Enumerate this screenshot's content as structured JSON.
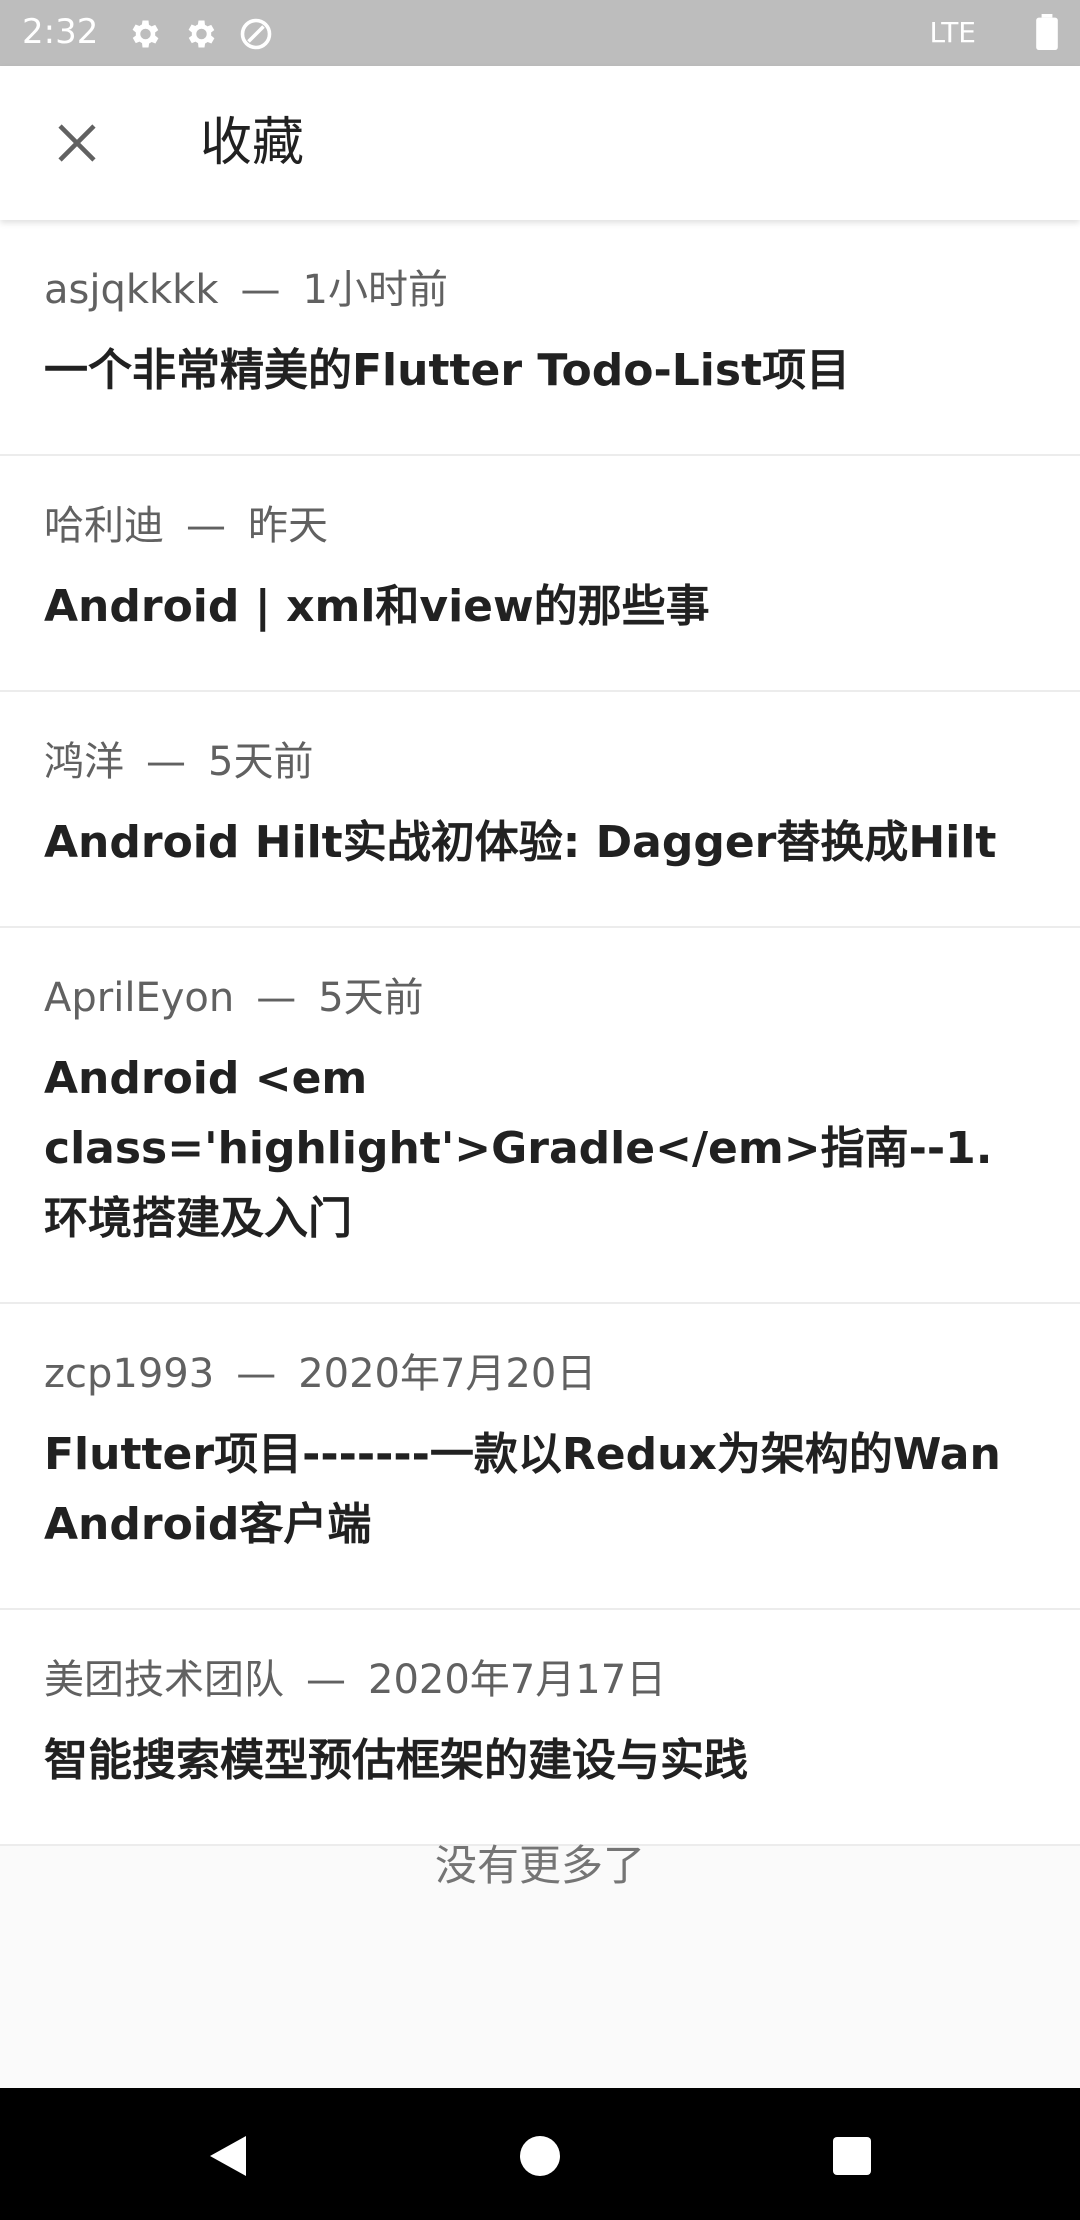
{
  "status_bar": {
    "time": "2:32",
    "network": "LTE",
    "icons": [
      "gear-icon",
      "gear-icon",
      "sync-disabled-icon",
      "battery-icon"
    ]
  },
  "app_bar": {
    "title": "收藏",
    "close_icon": "close-icon"
  },
  "articles": [
    {
      "author": "asjqkkkk",
      "sep": "—",
      "time": "1小时前",
      "title": "一个非常精美的Flutter Todo-List项目"
    },
    {
      "author": "哈利迪",
      "sep": "—",
      "time": "昨天",
      "title": "Android | xml和view的那些事"
    },
    {
      "author": "鸿洋",
      "sep": "—",
      "time": "5天前",
      "title": "Android Hilt实战初体验: Dagger替换成Hilt"
    },
    {
      "author": "AprilEyon",
      "sep": "—",
      "time": "5天前",
      "title": "Android <em class='highlight'>Gradle</em>指南--1.环境搭建及入门"
    },
    {
      "author": "zcp1993",
      "sep": "—",
      "time": "2020年7月20日",
      "title": "Flutter项目-------一款以Redux为架构的Wan Android客户端"
    },
    {
      "author": "美团技术团队",
      "sep": "—",
      "time": "2020年7月17日",
      "title": "智能搜索模型预估框架的建设与实践"
    }
  ],
  "footer": {
    "no_more": "没有更多了"
  },
  "nav_bar": {
    "icons": [
      "back-icon",
      "home-icon",
      "recents-icon"
    ]
  }
}
